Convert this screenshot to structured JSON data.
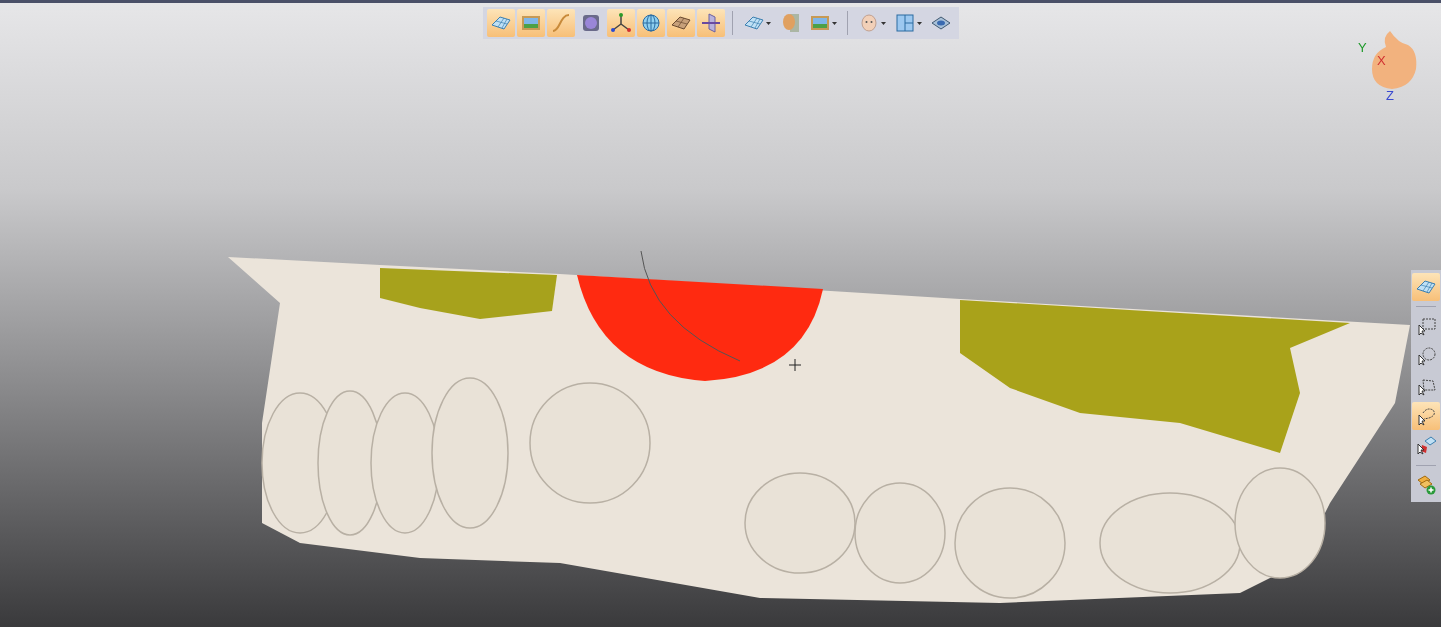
{
  "top_toolbar": {
    "groups": [
      [
        {
          "kind": "mesh",
          "selected": true,
          "dropdown": false
        },
        {
          "kind": "picture",
          "selected": true,
          "dropdown": false
        },
        {
          "kind": "curve",
          "selected": true,
          "dropdown": false
        },
        {
          "kind": "sphere",
          "selected": false,
          "dropdown": false
        },
        {
          "kind": "axes",
          "selected": true,
          "dropdown": false
        },
        {
          "kind": "globe",
          "selected": true,
          "dropdown": false
        },
        {
          "kind": "texture",
          "selected": true,
          "dropdown": false
        },
        {
          "kind": "plane",
          "selected": true,
          "dropdown": false
        }
      ],
      [
        {
          "kind": "mesh",
          "selected": false,
          "dropdown": true
        },
        {
          "kind": "head",
          "selected": false,
          "dropdown": false
        },
        {
          "kind": "picture",
          "selected": false,
          "dropdown": true
        }
      ],
      [
        {
          "kind": "face",
          "selected": false,
          "dropdown": true
        },
        {
          "kind": "layout",
          "selected": false,
          "dropdown": true
        },
        {
          "kind": "plate",
          "selected": false,
          "dropdown": false
        }
      ]
    ]
  },
  "view_gizmo": {
    "labels": [
      {
        "kind": "y",
        "text": "Y"
      },
      {
        "kind": "x",
        "text": "X"
      },
      {
        "kind": "z",
        "text": "Z"
      }
    ]
  },
  "side_toolbar": {
    "groups": [
      [
        {
          "kind": "mesh",
          "selected": true
        }
      ],
      [
        {
          "kind": "rect-select",
          "selected": false
        },
        {
          "kind": "circle-select",
          "selected": false
        },
        {
          "kind": "polygon-select",
          "selected": false
        },
        {
          "kind": "lasso-select",
          "selected": true
        },
        {
          "kind": "paint",
          "selected": false
        }
      ],
      [
        {
          "kind": "add-layer",
          "selected": false
        }
      ]
    ]
  }
}
